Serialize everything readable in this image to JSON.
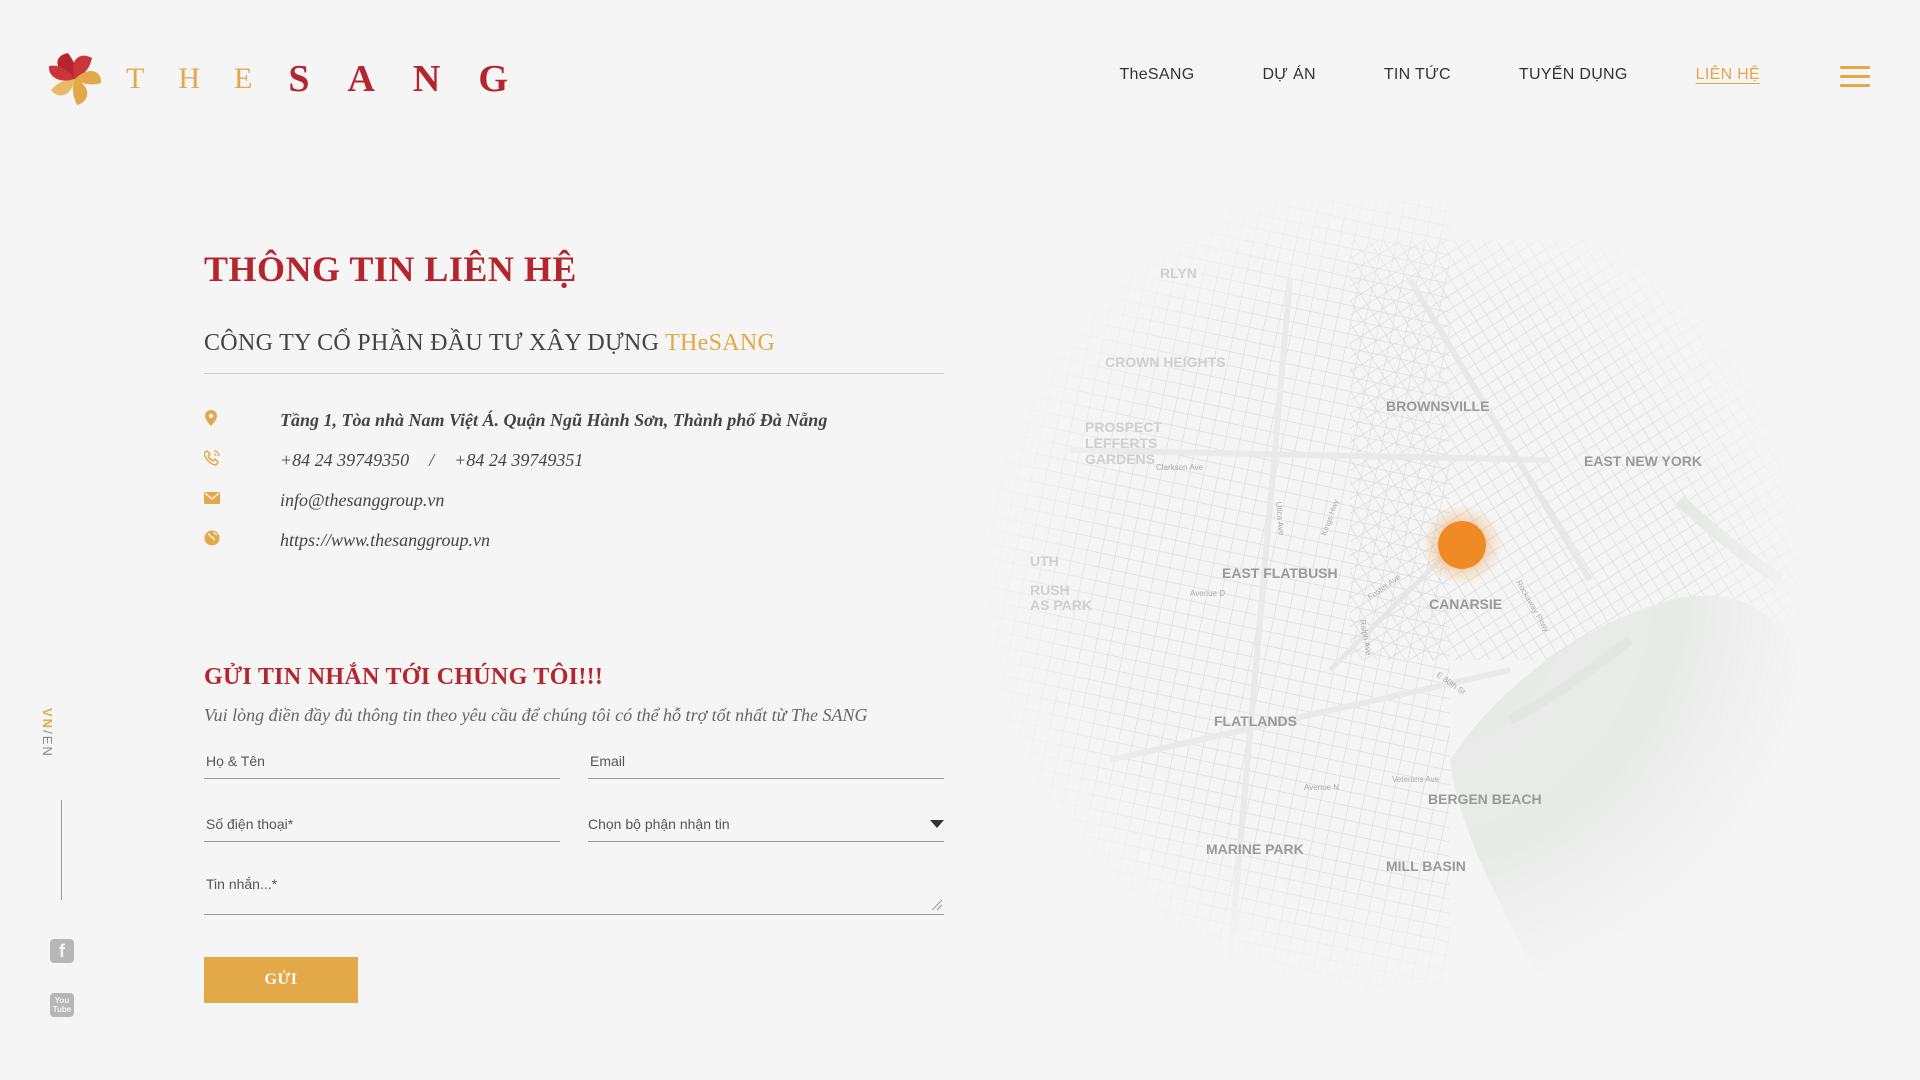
{
  "header": {
    "logo": {
      "the": "THE",
      "sang": "SANG"
    },
    "nav": [
      {
        "label": "TheSANG",
        "active": false
      },
      {
        "label": "DỰ ÁN",
        "active": false
      },
      {
        "label": "TIN TỨC",
        "active": false
      },
      {
        "label": "TUYỂN DỤNG",
        "active": false
      },
      {
        "label": "LIÊN HỆ",
        "active": true
      }
    ]
  },
  "sidebar": {
    "lang_vn": "VN",
    "lang_sep": "/",
    "lang_en": "EN",
    "facebook_glyph": "f",
    "youtube_glyph": "You Tube"
  },
  "contact": {
    "title": "THÔNG TIN LIÊN HỆ",
    "company_prefix": "CÔNG TY CỔ PHẦN ĐẦU TƯ XÂY DỰNG ",
    "company_brand": "THeSANG",
    "address": "Tầng 1, Tòa nhà Nam Việt Á. Quận Ngũ Hành Sơn, Thành phố Đà Nẵng",
    "phone1": "+84 24 39749350",
    "phone_sep": "/",
    "phone2": "+84 24 39749351",
    "email": "info@thesanggroup.vn",
    "website": "https://www.thesanggroup.vn"
  },
  "form": {
    "title": "GỬI TIN NHẮN TỚI CHÚNG TÔI!!!",
    "subtitle": "Vui lòng điền đầy đủ thông tin theo yêu cầu để chúng tôi có thể hỗ trợ tốt nhất từ The SANG",
    "name_placeholder": "Họ & Tên",
    "email_placeholder": "Email",
    "phone_placeholder": "Số điện thoại*",
    "department_label": "Chọn bộ phận nhận tin",
    "message_placeholder": "Tin nhắn...*",
    "submit_label": "GỬI"
  },
  "map": {
    "labels": {
      "brownsville": "BROWNSVILLE",
      "east_new_york": "EAST NEW YORK",
      "east_flatbush": "EAST FLATBUSH",
      "canarsie": "CANARSIE",
      "flatlands": "FLATLANDS",
      "bergen_beach": "BERGEN BEACH",
      "marine_park": "MARINE PARK",
      "mill_basin": "MILL BASIN",
      "crown_heights": "CROWN HEIGHTS",
      "prospect": "PROSPECT",
      "lefferts": "LEFFERTS",
      "gardens": "GARDENS",
      "rlyn": "RLYN",
      "rush": "RUSH",
      "as_park": "AS PARK",
      "uth": "UTH"
    },
    "streets": {
      "foster_ave": "Foster Ave",
      "avenue_d": "Avenue D",
      "ralph_ave": "Ralph Ave",
      "e_80th_st": "E 80th St",
      "utica_ave": "Utica Ave",
      "rockaway_pkwy": "Rockaway Pkwy",
      "veterans_ave": "Veterans Ave",
      "clarkson_ave": "Clarkson Ave",
      "kings_hwy": "Kings Hwy",
      "avenue_n": "Avenue N"
    },
    "pin_color": "#f08a24"
  },
  "colors": {
    "brand_red": "#b5252e",
    "brand_gold": "#e3a847"
  }
}
